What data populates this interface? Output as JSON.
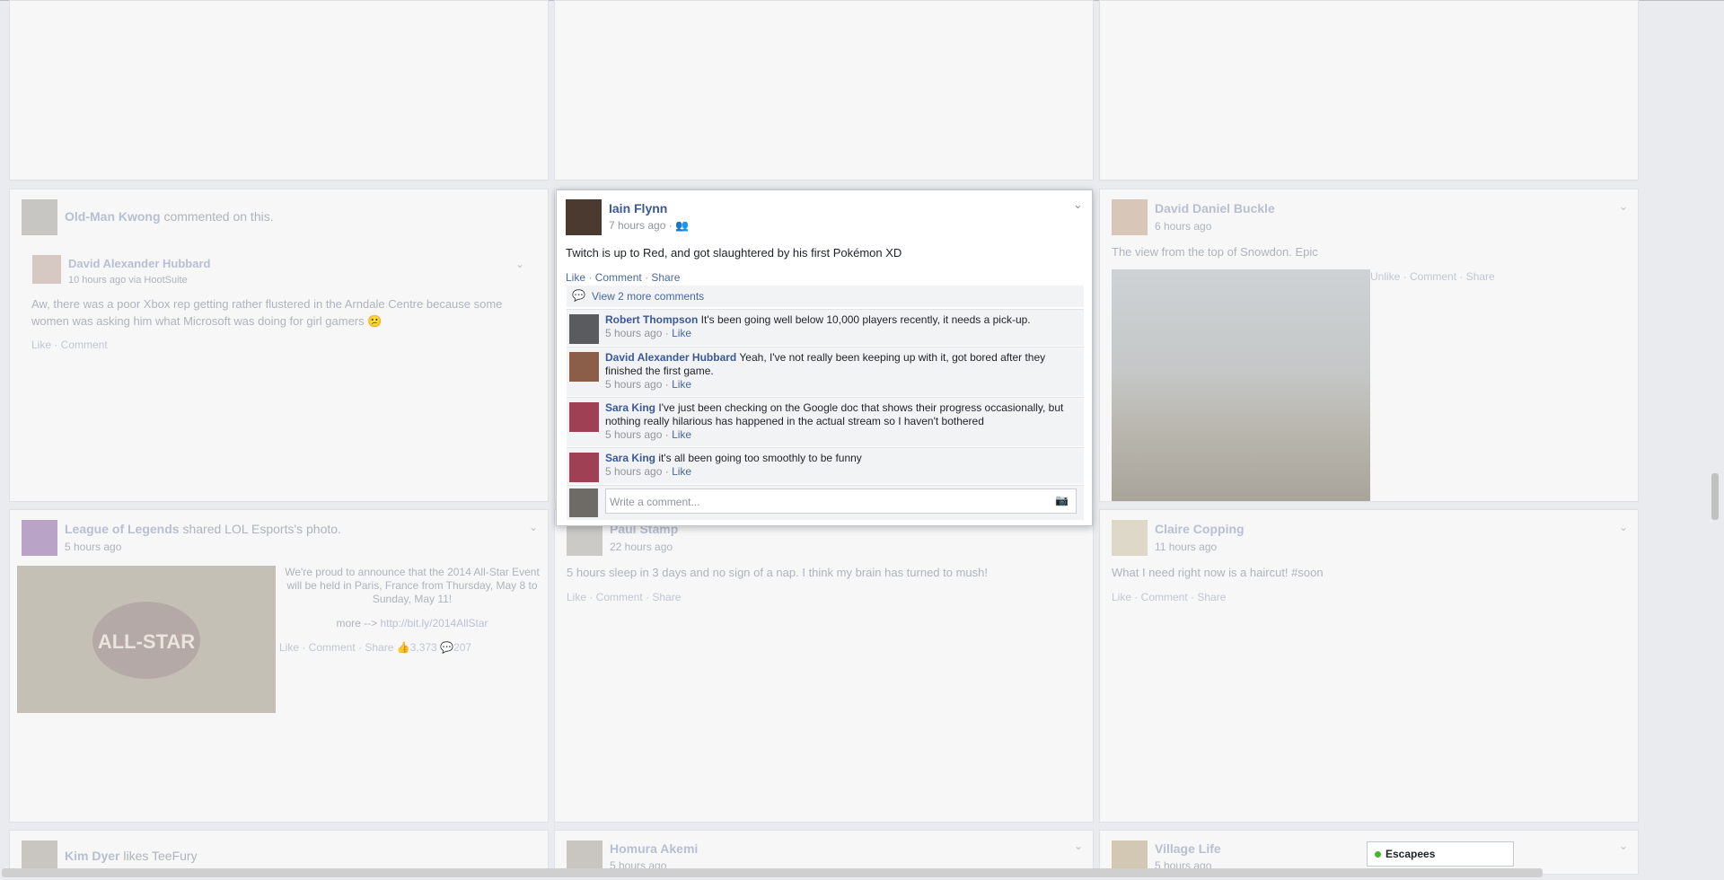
{
  "left_col": {
    "story1": {
      "actor": "Old-Man Kwong",
      "action": "commented on this.",
      "author": "David Alexander Hubbard",
      "time": "10 hours ago via HootSuite",
      "text": "Aw, there was a poor Xbox rep getting rather flustered in the Arndale Centre because some women was asking him what Microsoft was doing for girl gamers 😕",
      "actions": "Like · Comment"
    },
    "story2": {
      "actor": "League of Legends",
      "action": "shared LOL Esports's photo.",
      "time": "5 hours ago",
      "text": "We're proud to announce that the 2014 All-Star Event will be held in Paris, France from Thursday, May 8 to Sunday, May 11!",
      "more": "more --> ",
      "url": "http://bit.ly/2014AllStar",
      "actions": "Like · Comment · Share",
      "likes": "3,373",
      "comments": "207",
      "image_label": "ALL-STAR"
    },
    "story3": {
      "actor": "Kim Dyer",
      "action": "likes TeeFury"
    }
  },
  "mid_col": {
    "story2": {
      "author": "Paul Stamp",
      "time": "22 hours ago",
      "text": "5 hours sleep in 3 days and no sign of a nap. I think my brain has turned to mush!",
      "actions": "Like · Comment · Share"
    },
    "story3": {
      "author": "Homura Akemi",
      "time": "5 hours ago"
    }
  },
  "right_col": {
    "story1": {
      "author": "David Daniel Buckle",
      "time": "6 hours ago",
      "text": "The view from the top of Snowdon. Epic",
      "actions": "Unlike · Comment · Share"
    },
    "story2": {
      "author": "Claire Copping",
      "time": "11 hours ago",
      "text": "What I need right now is a haircut! #soon",
      "actions": "Like · Comment · Share"
    },
    "story3": {
      "author": "Village Life",
      "time": "5 hours ago"
    }
  },
  "focus_post": {
    "author": "Iain Flynn",
    "time": "7 hours ago",
    "text": "Twitch is up to Red, and got slaughtered by his first Pokémon XD",
    "action_like": "Like",
    "action_comment": "Comment",
    "action_share": "Share",
    "view_more": "View 2 more comments",
    "comments": [
      {
        "name": "Robert Thompson",
        "text": "It's been going well below 10,000 players recently, it needs a pick-up.",
        "time": "5 hours ago",
        "like": "Like"
      },
      {
        "name": "David Alexander Hubbard",
        "text": "Yeah, I've not really been keeping up with it, got bored after they finished the first game.",
        "time": "5 hours ago",
        "like": "Like"
      },
      {
        "name": "Sara King",
        "text": "I've just been checking on the Google doc that shows their progress occasionally, but nothing really hilarious has happened in the actual stream so I haven't bothered",
        "time": "5 hours ago",
        "like": "Like"
      },
      {
        "name": "Sara King",
        "text": "it's all been going too smoothly to be funny",
        "time": "5 hours ago",
        "like": "Like"
      }
    ],
    "write_placeholder": "Write a comment..."
  },
  "chat": {
    "label": "Escapees",
    "status_color": "#42b72a"
  }
}
